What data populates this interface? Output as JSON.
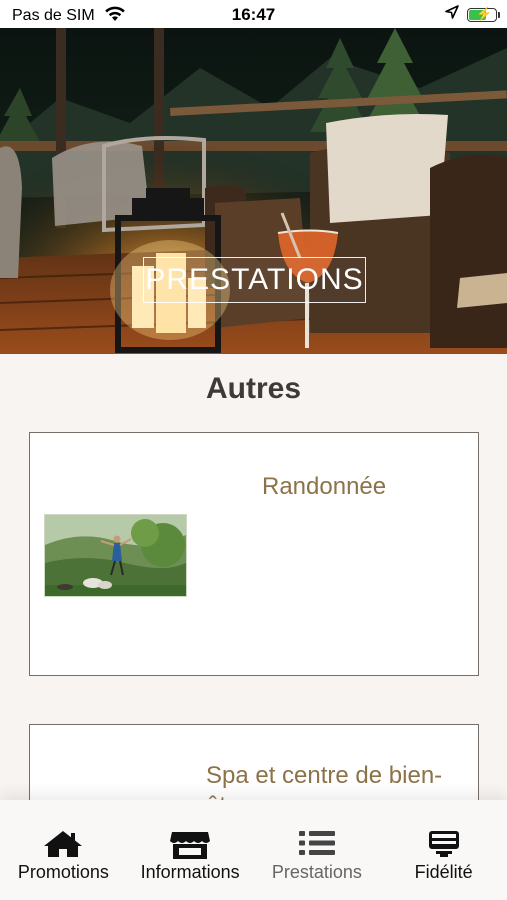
{
  "status_bar": {
    "carrier": "Pas de SIM",
    "time": "16:47",
    "icons": [
      "wifi-icon",
      "location-arrow-icon",
      "battery-charging-icon"
    ]
  },
  "hero": {
    "title": "PRESTATIONS"
  },
  "section": {
    "heading": "Autres"
  },
  "cards": [
    {
      "title": "Randonnée",
      "image": "hiking-thumbnail"
    },
    {
      "title": "Spa et centre de bien-être",
      "image": ""
    }
  ],
  "tabs": [
    {
      "label": "Promotions",
      "icon": "home-icon",
      "active": true
    },
    {
      "label": "Informations",
      "icon": "store-icon",
      "active": true
    },
    {
      "label": "Prestations",
      "icon": "list-icon",
      "active": false
    },
    {
      "label": "Fidélité",
      "icon": "loyalty-card-icon",
      "active": true
    }
  ],
  "colors": {
    "accent_title": "#8c7248",
    "heading": "#3d3a37",
    "card_border": "#77706a",
    "background": "#f7f4f2",
    "battery_green": "#39c24a"
  }
}
